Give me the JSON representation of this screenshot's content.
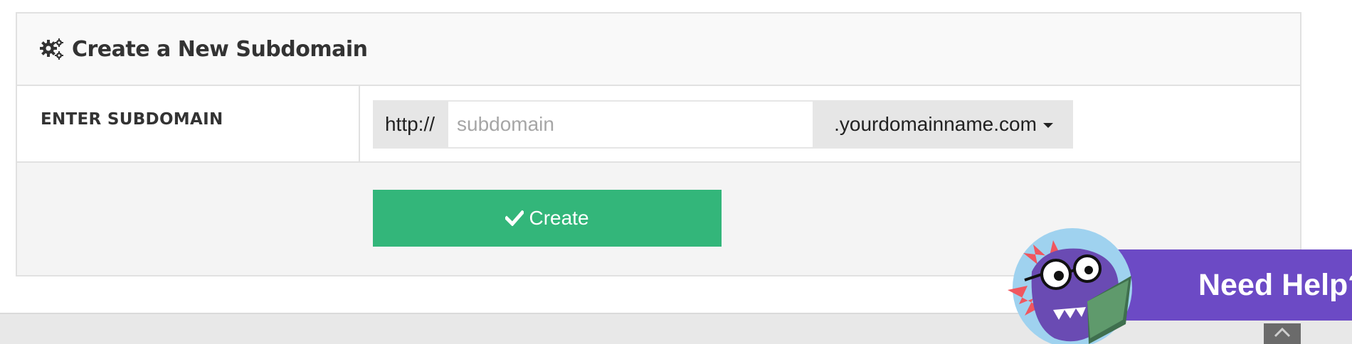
{
  "panel": {
    "title": "Create a New Subdomain",
    "heading_icon": "gears-icon"
  },
  "form": {
    "label": "ENTER SUBDOMAIN",
    "prefix": "http://",
    "subdomain_placeholder": "subdomain",
    "subdomain_value": "",
    "domain_selected": ".yourdomainname.com",
    "dropdown_icon": "caret-down-icon"
  },
  "actions": {
    "create_label": "Create",
    "create_icon": "check-icon",
    "create_color": "#33b67a"
  },
  "help_widget": {
    "label": "Need Help?",
    "color": "#6c4ac5",
    "mascot_icon": "dinosaur-mascot-icon"
  },
  "footer": {
    "scroll_top_icon": "chevron-up-icon"
  }
}
